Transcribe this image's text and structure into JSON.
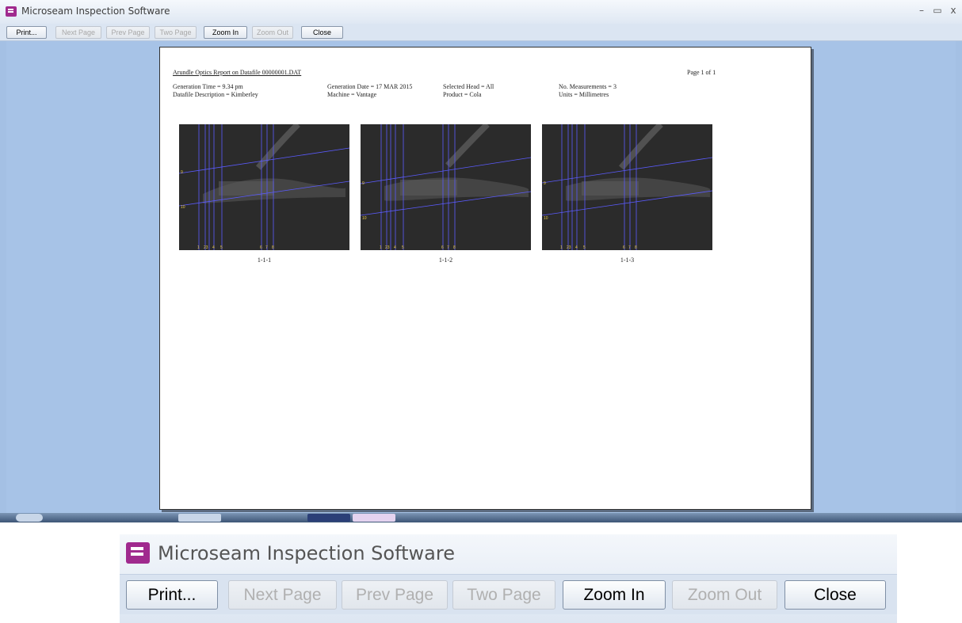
{
  "window": {
    "title": "Microseam Inspection Software",
    "controls": [
      "–",
      "▭",
      "x"
    ]
  },
  "toolbar": {
    "buttons": [
      {
        "label": "Print...",
        "enabled": true
      },
      {
        "label": "Next Page",
        "enabled": false
      },
      {
        "label": "Prev Page",
        "enabled": false
      },
      {
        "label": "Two Page",
        "enabled": false
      },
      {
        "label": "Zoom In",
        "enabled": true
      },
      {
        "label": "Zoom Out",
        "enabled": false
      },
      {
        "label": "Close",
        "enabled": true
      }
    ]
  },
  "report": {
    "title": "Arundle Optics Report on Datafile 00000001.DAT",
    "page_label": "Page 1 of 1",
    "fields": [
      "Generation Time = 9.34 pm",
      "Generation Date = 17 MAR 2015",
      "Selected Head = All",
      "No. Measurements = 3",
      "Datafile Description = Kimberley",
      "Machine = Vantage",
      "Product = Cola",
      "Units = Millimetres"
    ],
    "images": [
      {
        "caption": "1-1-1",
        "left_labels": [
          "9",
          "10"
        ],
        "bottom_labels": [
          "1",
          "23",
          "4",
          "5",
          "6",
          "7",
          "8"
        ]
      },
      {
        "caption": "1-1-2",
        "left_labels": [
          "9",
          "10"
        ],
        "bottom_labels": [
          "1",
          "23",
          "4",
          "5",
          "6",
          "7",
          "8"
        ]
      },
      {
        "caption": "1-1-3",
        "left_labels": [
          "9",
          "10"
        ],
        "bottom_labels": [
          "1",
          "23",
          "4",
          "5",
          "6",
          "7",
          "8"
        ]
      }
    ]
  },
  "inset": {
    "title": "Microseam Inspection Software",
    "buttons": [
      {
        "label": "Print...",
        "enabled": true
      },
      {
        "label": "Next Page",
        "enabled": false
      },
      {
        "label": "Prev Page",
        "enabled": false
      },
      {
        "label": "Two Page",
        "enabled": false
      },
      {
        "label": "Zoom In",
        "enabled": true
      },
      {
        "label": "Zoom Out",
        "enabled": false
      },
      {
        "label": "Close",
        "enabled": true
      }
    ]
  },
  "colors": {
    "workspace": "#a7c3e7",
    "app_icon": "#a02a8e",
    "measure_line": "#5b5bff",
    "thumb_bg": "#2b2b2b"
  }
}
